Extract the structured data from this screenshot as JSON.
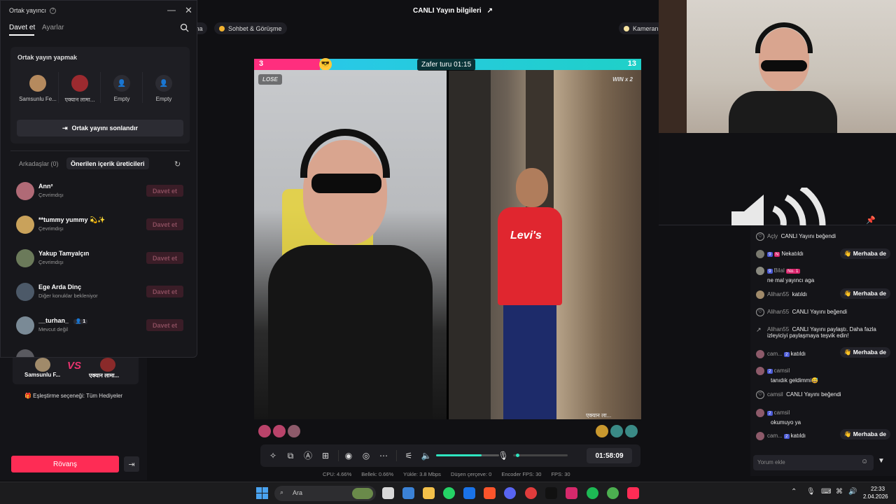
{
  "header": {
    "stream_title": "CANLI Yayın bilgileri",
    "chips": [
      "ma",
      "Sohbet & Görüşme",
      "Kameranın"
    ]
  },
  "popup": {
    "title": "Ortak yayıncı",
    "tabs": [
      "Davet et",
      "Ayarlar"
    ],
    "cohost_heading": "Ortak yayın yapmak",
    "slots": [
      "Samsunlu Fe...",
      "एक्यान लामा...",
      "Empty",
      "Empty"
    ],
    "end_button": "Ortak yayını sonlandır",
    "friends_tab": "Arkadaşlar (0)",
    "suggested_tab": "Önerilen içerik üreticileri",
    "invite_label": "Davet et",
    "rows": [
      {
        "name": "Ann²",
        "status": "Çevrimdışı",
        "color": "#b06a76"
      },
      {
        "name": "**tummy yummy 💫✨",
        "status": "Çevrimdışı",
        "color": "#c9a25b"
      },
      {
        "name": "Yakup Tamyalçın",
        "status": "Çevrimdışı",
        "color": "#6b7a5a"
      },
      {
        "name": "Ege Arda Dinç",
        "status": "Diğer konuklar bekleniyor",
        "color": "#4c5968"
      },
      {
        "name": "__turhan_",
        "extra": "1",
        "status": "Mevcut değil",
        "color": "#7a8a96"
      }
    ]
  },
  "battle_card": {
    "left_name": "Samsunlu F...",
    "right_name": "एक्यान लामा...",
    "vs": "VS",
    "match_option": "🎁 Eşleştirme seçeneği: Tüm Hediyeler"
  },
  "buttons": {
    "rematch": "Rövanş"
  },
  "battle": {
    "score_left": "3",
    "score_right": "13",
    "left_badge": "LOSE",
    "right_badge": "WIN x 2",
    "timer": "Zafer turu 01:15",
    "right_tag": "एक्यान ला...",
    "left_share": 0.17
  },
  "controls": {
    "duration": "01:58:09",
    "volume": 0.72,
    "mic": 0.05
  },
  "stats": [
    "CPU: 4.66%",
    "Bellek: 0.66%",
    "Yükle: 3.8 Mbps",
    "Düşen çerçeve: 0",
    "Encoder FPS: 30",
    "FPS: 30"
  ],
  "chat": {
    "messages": [
      {
        "user": "Açly",
        "text": "CANLI Yayını beğendi",
        "icon": "heart"
      },
      {
        "user": "",
        "lvl": "9",
        "fan": "N",
        "text": "Nekatıldı",
        "hi": "👋 Merhaba de"
      },
      {
        "user": "Bilal",
        "lvl": "9",
        "fan": "No. 1",
        "text": "ne mal yayıncı aga"
      },
      {
        "user": "Alihan55",
        "text": "katıldı",
        "hi": "👋 Merhaba de"
      },
      {
        "user": "Alihan55",
        "text": "CANLI Yayını beğendi",
        "icon": "heart"
      },
      {
        "user": "Alihan55",
        "text": "CANLI Yayını paylaştı. Daha fazla izleyiciyi paylaşmaya teşvik edin!",
        "icon": "share"
      },
      {
        "user": "cam...",
        "lvl": "2",
        "text": "katıldı",
        "hi": "👋 Merhaba de"
      },
      {
        "user": "camsil",
        "lvl": "2",
        "text": "tanıdık geldimmi😅"
      },
      {
        "user": "camsil",
        "text": "CANLI Yayını beğendi",
        "icon": "heart"
      },
      {
        "user": "camsil",
        "lvl": "2",
        "text": "okumuyo ya"
      },
      {
        "user": "cam...",
        "lvl": "2",
        "text": "katıldı",
        "hi": "👋 Merhaba de"
      }
    ],
    "placeholder": "Yorum ekle"
  },
  "taskbar": {
    "search": "Ara",
    "time": "22:33",
    "date": "2.04.2026"
  }
}
